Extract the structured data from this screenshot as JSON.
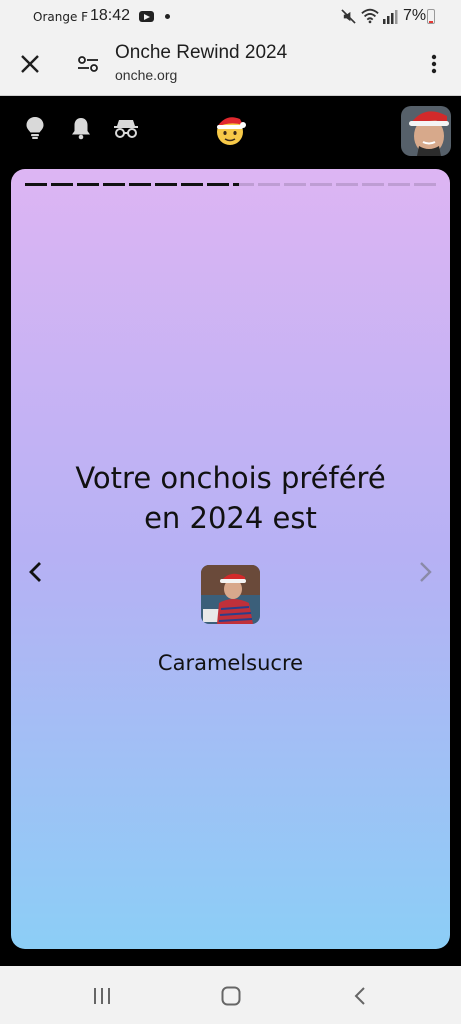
{
  "status_bar": {
    "carrier": "Orange F",
    "time": "18:42",
    "battery": "7%"
  },
  "browser": {
    "title": "Onche Rewind 2024",
    "url": "onche.org"
  },
  "story": {
    "total_segments": 16,
    "completed_segments": 8,
    "current_segment_progress": 0.3,
    "headline_line1": "Votre onchois préféré",
    "headline_line2": "en 2024 est",
    "favorite_name": "Caramelsucre"
  },
  "colors": {
    "gradient_top": "#ddb5f3",
    "gradient_bottom": "#8ccef6",
    "header_bg": "#000000"
  }
}
